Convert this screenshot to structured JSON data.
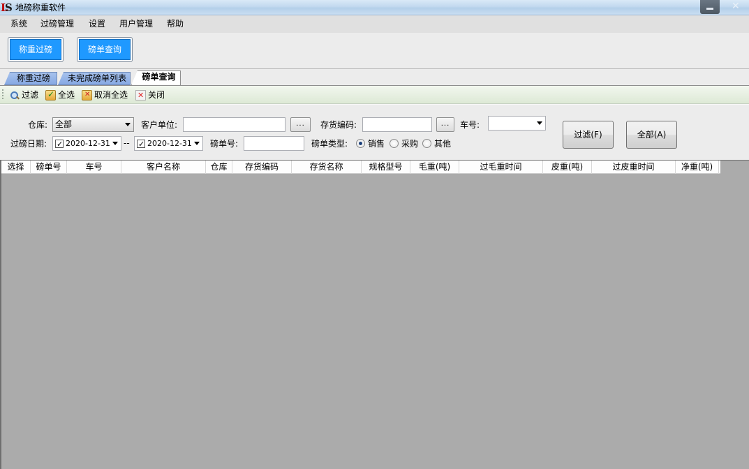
{
  "window": {
    "title": "地磅称重软件"
  },
  "menu": [
    "系统",
    "过磅管理",
    "设置",
    "用户管理",
    "帮助"
  ],
  "big_buttons": {
    "weigh": "称重过磅",
    "query": "磅单查询"
  },
  "tabs": [
    {
      "label": "称重过磅",
      "active": false
    },
    {
      "label": "未完成磅单列表",
      "active": false
    },
    {
      "label": "磅单查询",
      "active": true
    }
  ],
  "toolbar": {
    "filter": "过滤",
    "select_all": "全选",
    "deselect_all": "取消全选",
    "close": "关闭"
  },
  "filter": {
    "warehouse_label": "仓库:",
    "warehouse_value": "全部",
    "customer_label": "客户单位:",
    "customer_value": "",
    "ellipsis": "...",
    "stock_code_label": "存货编码:",
    "stock_code_value": "",
    "plate_label": "车号:",
    "plate_value": "",
    "date_label": "过磅日期:",
    "date_from": "2020-12-31",
    "date_sep": "--",
    "date_to": "2020-12-31",
    "slip_no_label": "磅单号:",
    "slip_no_value": "",
    "type_label": "磅单类型:",
    "types": [
      {
        "label": "销售",
        "checked": true
      },
      {
        "label": "采购",
        "checked": false
      },
      {
        "label": "其他",
        "checked": false
      }
    ],
    "filter_button": "过滤(F)",
    "all_button": "全部(A)"
  },
  "grid": {
    "columns": [
      "选择",
      "磅单号",
      "车号",
      "客户名称",
      "仓库",
      "存货编码",
      "存货名称",
      "规格型号",
      "毛重(吨)",
      "过毛重时间",
      "皮重(吨)",
      "过皮重时间",
      "净重(吨)"
    ],
    "rows": []
  },
  "colors": {
    "accent_button": "#1f99ff",
    "grid_background": "#ababab",
    "tab_inactive": "#8fb0e7"
  }
}
